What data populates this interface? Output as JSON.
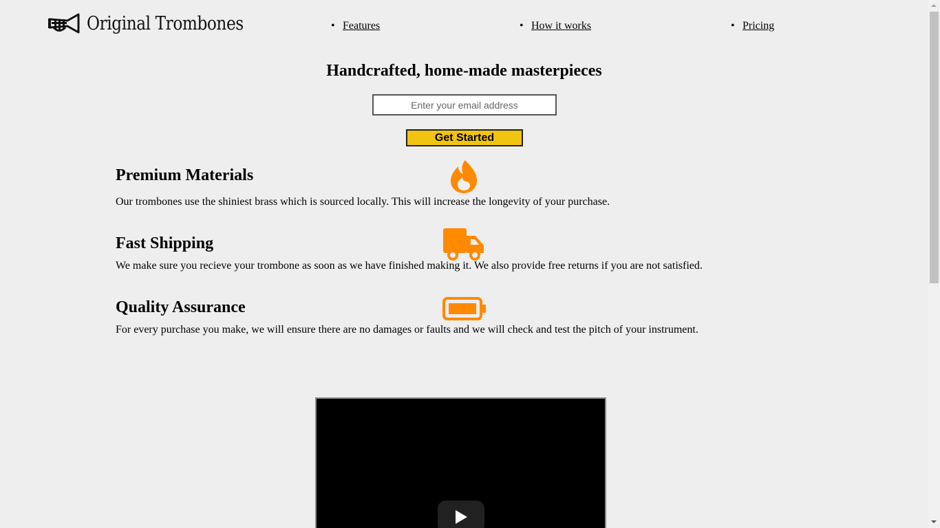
{
  "header": {
    "logo_text": "Original Trombones",
    "logo_icon": "trumpet-icon",
    "nav": [
      {
        "label": "Features"
      },
      {
        "label": "How it works"
      },
      {
        "label": "Pricing"
      }
    ]
  },
  "hero": {
    "title": "Handcrafted, home-made masterpieces",
    "email_placeholder": "Enter your email address",
    "cta_label": "Get Started"
  },
  "features": [
    {
      "title": "Premium Materials",
      "text": "Our trombones use the shiniest brass which is sourced locally. This will increase the longevity of your purchase.",
      "icon": "fire-icon"
    },
    {
      "title": "Fast Shipping",
      "text": "We make sure you recieve your trombone as soon as we have finished making it. We also provide free returns if you are not satisfied.",
      "icon": "truck-icon"
    },
    {
      "title": "Quality Assurance",
      "text": "For every purchase you make, we will ensure there are no damages or faults and we will check and test the pitch of your instrument.",
      "icon": "battery-icon"
    }
  ],
  "video": {
    "play_icon": "play-icon"
  },
  "colors": {
    "background": "#eeeeee",
    "accent_orange": "#ff8a00",
    "cta_yellow": "#f1c40f",
    "video_bg": "#000000"
  }
}
